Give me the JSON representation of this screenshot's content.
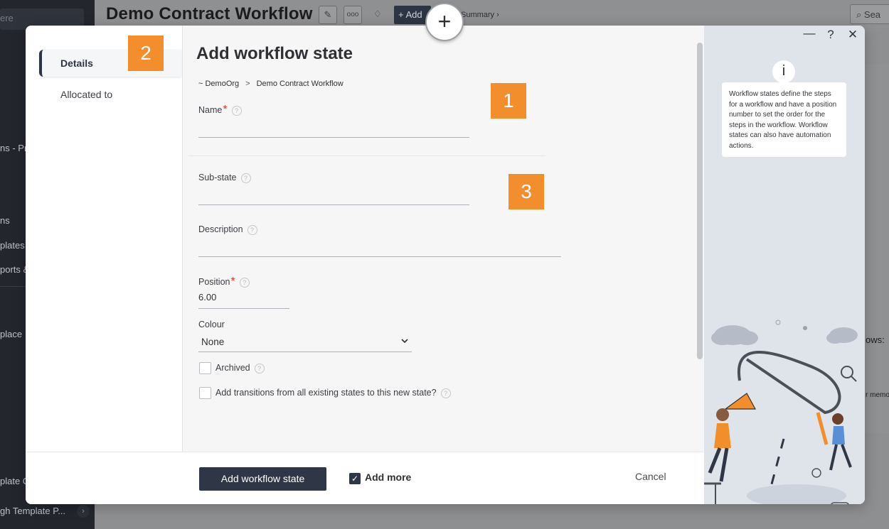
{
  "background": {
    "sidebar": {
      "search_placeholder": "ere",
      "items": [
        "ns - Pro",
        "ns",
        "plates",
        "ports &",
        "place",
        "plate C",
        "gh Template P..."
      ]
    },
    "header": {
      "title": "Demo Contract Workflow",
      "add_label": "+ Add",
      "summary_link": "Summary ›",
      "search_placeholder": "Sea"
    },
    "right_fragments": {
      "rows_text": "ows:",
      "memo_text": "r memo"
    }
  },
  "modal": {
    "nav": {
      "items": [
        {
          "label": "Details",
          "active": true
        },
        {
          "label": "Allocated to",
          "active": false
        }
      ]
    },
    "callouts": {
      "one": "1",
      "two": "2",
      "three": "3"
    },
    "callout_color": "#f28f2c",
    "form": {
      "title": "Add workflow state",
      "breadcrumb": {
        "org": "~ DemoOrg",
        "separator": ">",
        "workflow": "Demo Contract Workflow"
      },
      "name": {
        "label": "Name",
        "required_mark": "*",
        "value": ""
      },
      "substate": {
        "label": "Sub-state",
        "value": ""
      },
      "description": {
        "label": "Description",
        "value": ""
      },
      "position": {
        "label": "Position",
        "required_mark": "*",
        "value": "6.00"
      },
      "colour": {
        "label": "Colour",
        "selected": "None"
      },
      "archived": {
        "label": "Archived",
        "checked": false
      },
      "transitions": {
        "label": "Add transitions from all existing states to this new state?",
        "checked": false
      },
      "help_glyph": "?"
    },
    "footer": {
      "primary_label": "Add workflow state",
      "add_more_label": "Add more",
      "add_more_checked": true,
      "check_glyph": "✓",
      "cancel_label": "Cancel"
    },
    "help_panel": {
      "minimize_glyph": "—",
      "help_glyph": "?",
      "close_glyph": "✕",
      "info_glyph": "i",
      "text": "Workflow states define the steps for a workflow and have a position number to set the order for the steps in the workflow. Workflow states can also have automation actions."
    },
    "plus_glyph": "+"
  },
  "colors": {
    "primary": "#2f3646",
    "required": "#e0312c",
    "panel_bg": "#dfe3ea",
    "accent_orange": "#f28f2c"
  }
}
